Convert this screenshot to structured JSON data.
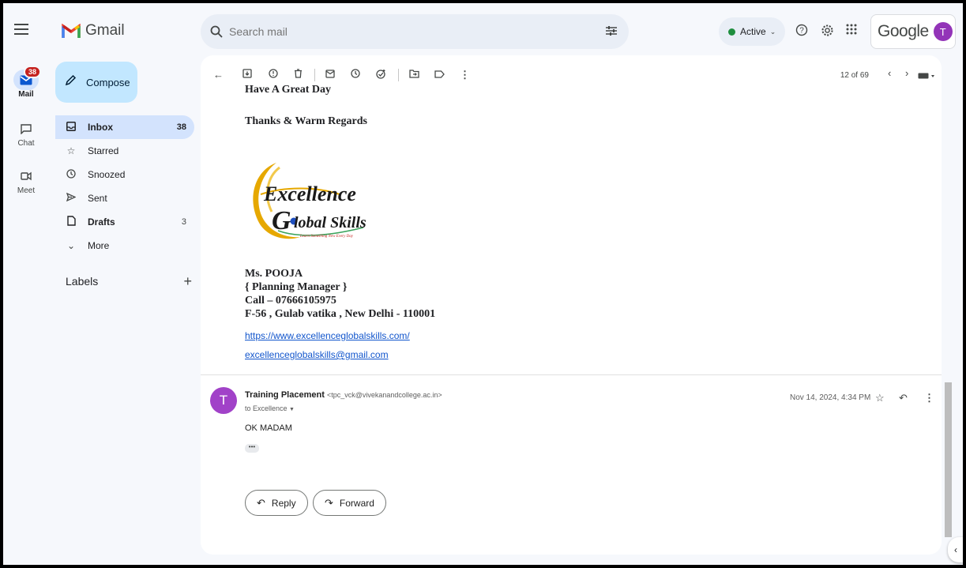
{
  "app": {
    "name": "Gmail"
  },
  "rail": {
    "items": [
      {
        "label": "Mail",
        "badge": "38",
        "icon": "mail-icon"
      },
      {
        "label": "Chat",
        "icon": "chat-icon"
      },
      {
        "label": "Meet",
        "icon": "video-icon"
      }
    ]
  },
  "search": {
    "placeholder": "Search mail"
  },
  "header": {
    "status": "Active",
    "account_word": "Google",
    "avatar_letter": "T"
  },
  "sidebar": {
    "compose": "Compose",
    "items": [
      {
        "label": "Inbox",
        "count": "38",
        "icon": "inbox-icon"
      },
      {
        "label": "Starred",
        "count": "",
        "icon": "star-icon"
      },
      {
        "label": "Snoozed",
        "count": "",
        "icon": "clock-icon"
      },
      {
        "label": "Sent",
        "count": "",
        "icon": "send-icon"
      },
      {
        "label": "Drafts",
        "count": "3",
        "icon": "draft-icon"
      },
      {
        "label": "More",
        "count": "",
        "icon": "chevron-down-icon"
      }
    ],
    "labels_title": "Labels"
  },
  "toolbar": {
    "pager": "12 of 69"
  },
  "email": {
    "cut_line": "Have A Great Day",
    "thanks": "Thanks & Warm Regards",
    "brand": {
      "line1": "Excellence",
      "line2_a": "G",
      "line2_b": "lobal Skills",
      "tagline": "Learn Something New Every Day"
    },
    "signature": [
      "Ms. POOJA",
      "{ Planning Manager }",
      "Call – 07666105975",
      "F-56 , Gulab vatika , New Delhi - 110001"
    ],
    "links": [
      "https://www.excellenceglobalskills.com/",
      "excellenceglobalskills@gmail.com"
    ]
  },
  "reply": {
    "avatar_letter": "T",
    "sender_name": "Training Placement",
    "sender_email": "<tpc_vck@vivekanandcollege.ac.in>",
    "to_line": "to Excellence",
    "date": "Nov 14, 2024, 4:34 PM",
    "body": "OK MADAM",
    "dots": "•••"
  },
  "actions": {
    "reply": "Reply",
    "forward": "Forward"
  },
  "colors": {
    "accent": "#0b57d0",
    "compose_bg": "#c2e7ff",
    "active_nav": "#d3e3fd",
    "link": "#1155cc"
  }
}
